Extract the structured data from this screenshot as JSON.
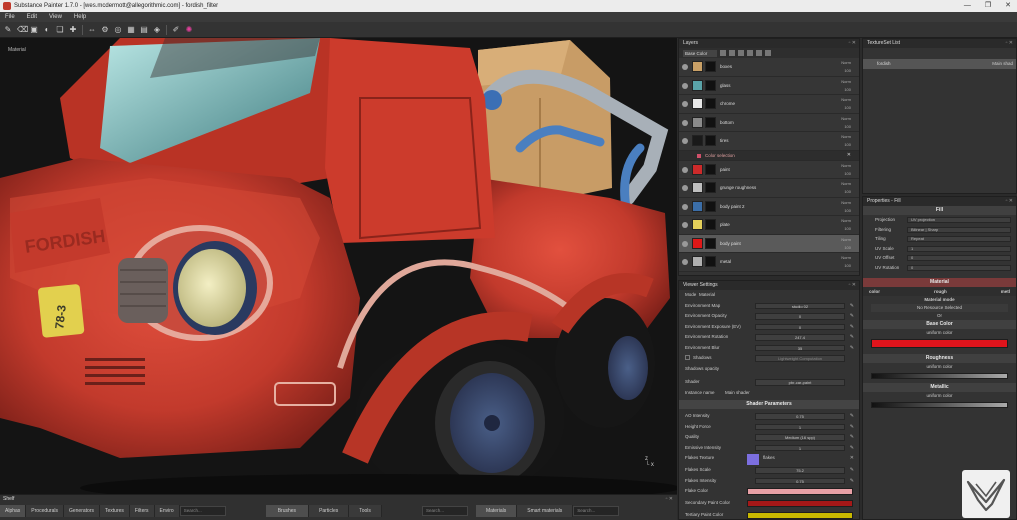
{
  "window": {
    "title": "Substance Painter 1.7.0 - [wes.mcdermott@allegorithmic.com] - fordish_filter",
    "controls": [
      "—",
      "❐",
      "✕"
    ]
  },
  "menu": [
    "File",
    "Edit",
    "View",
    "Help"
  ],
  "viewport": {
    "mode_label": "Material",
    "truck_text": "FORDISH",
    "plate_text": "78-3"
  },
  "layers": {
    "title": "Layers",
    "channel": "Base Color",
    "rows": [
      {
        "name": "boxes",
        "blend": "Norm",
        "opacity": "100",
        "color": "#c9a066"
      },
      {
        "name": "glass",
        "blend": "Norm",
        "opacity": "100",
        "color": "#5aa3a8"
      },
      {
        "name": "chrome",
        "blend": "Norm",
        "opacity": "100",
        "color": "#e8e8e8"
      },
      {
        "name": "bottom",
        "blend": "Norm",
        "opacity": "100",
        "color": "#8a8a8a"
      },
      {
        "name": "tires",
        "blend": "Norm",
        "opacity": "100",
        "color": "#1a1a1a"
      },
      {
        "name": "Color selection",
        "effect": true
      },
      {
        "name": "paint",
        "blend": "Norm",
        "opacity": "100",
        "color": "#cc2a2a"
      },
      {
        "name": "grunge roughness",
        "blend": "Norm",
        "opacity": "100",
        "color": "#bfbfbf"
      },
      {
        "name": "body paint 2",
        "blend": "Norm",
        "opacity": "100",
        "color": "#3b6ea8"
      },
      {
        "name": "plate",
        "blend": "Norm",
        "opacity": "100",
        "color": "#e3cf5a"
      },
      {
        "name": "body paint",
        "blend": "Norm",
        "opacity": "100",
        "color": "#e01818",
        "active": true
      },
      {
        "name": "metal",
        "blend": "Norm",
        "opacity": "100",
        "color": "#b0b0b0"
      }
    ]
  },
  "viewer": {
    "title": "Viewer Settings",
    "mode_label": "Mode",
    "mode_value": "Material",
    "rows": [
      {
        "label": "Environment Map",
        "value": "studio 02"
      },
      {
        "label": "Environment Opacity",
        "value": "0"
      },
      {
        "label": "Environment Exposure (EV)",
        "value": "0"
      },
      {
        "label": "Environment Rotation",
        "value": "247.4"
      },
      {
        "label": "Environment Blur",
        "value": "35"
      }
    ],
    "shadows_label": "Shadows",
    "shadows_value": "Lightweight Computation",
    "shadows_opacity_label": "Shadows opacity",
    "shader_label": "Shader",
    "shader_value": "pbr-car-paint",
    "instance_label": "Instance name",
    "instance_value": "Main shader",
    "shader_params": "Shader Parameters",
    "params": [
      {
        "label": "AO Intensity",
        "value": "0.75"
      },
      {
        "label": "Height Force",
        "value": "1"
      },
      {
        "label": "Quality",
        "value": "Medium (16 spp)"
      },
      {
        "label": "Emissive Intensity",
        "value": "1"
      }
    ],
    "flakes_texture_label": "Flakes Texture",
    "flakes_texture_value": "flakes",
    "flakes_scale_label": "Flakes Scale",
    "flakes_scale_value": "75.2",
    "flakes_intensity_label": "Flakes Intensity",
    "flakes_intensity_value": "0.75",
    "flake_color_label": "Flake Color",
    "flake_color": "#e8a0a6",
    "secondary_label": "Secondary Paint Color",
    "secondary_color": "#a51818",
    "tertiary_label": "Tertiary Paint Color",
    "tertiary_color": "#c8b800"
  },
  "texset": {
    "title": "TextureSet List",
    "item": "fordish",
    "shader": "Main shad"
  },
  "properties": {
    "title": "Properties - Fill",
    "fill": "Fill",
    "rows": [
      {
        "label": "Projection",
        "value": "UV projection"
      },
      {
        "label": "Filtering",
        "value": "Bilinear | Sharp"
      },
      {
        "label": "Tiling",
        "value": "Repeat"
      },
      {
        "label": "UV Scale",
        "value": "1"
      },
      {
        "label": "UV Offset",
        "value": "0"
      },
      {
        "label": "UV Rotation",
        "value": "0"
      }
    ],
    "material": "Material",
    "channels": [
      "color",
      "rough",
      "metl"
    ],
    "material_mode": "Material mode",
    "no_resource": "No Resource Selected",
    "or": "Or",
    "base_color": "Base Color",
    "uniform_color": "uniform color",
    "base_color_value": "#e0141c",
    "roughness": "Roughness",
    "metallic": "Metallic"
  },
  "shelf": {
    "title": "Shelf",
    "tabs1": [
      "Alphas",
      "Procedurals",
      "Generators",
      "Textures",
      "Filters",
      "Enviro"
    ],
    "search": "Search...",
    "tabs2": [
      "Brushes",
      "Particles",
      "Tools"
    ],
    "tabs3": [
      "Materials",
      "Smart materials"
    ]
  }
}
